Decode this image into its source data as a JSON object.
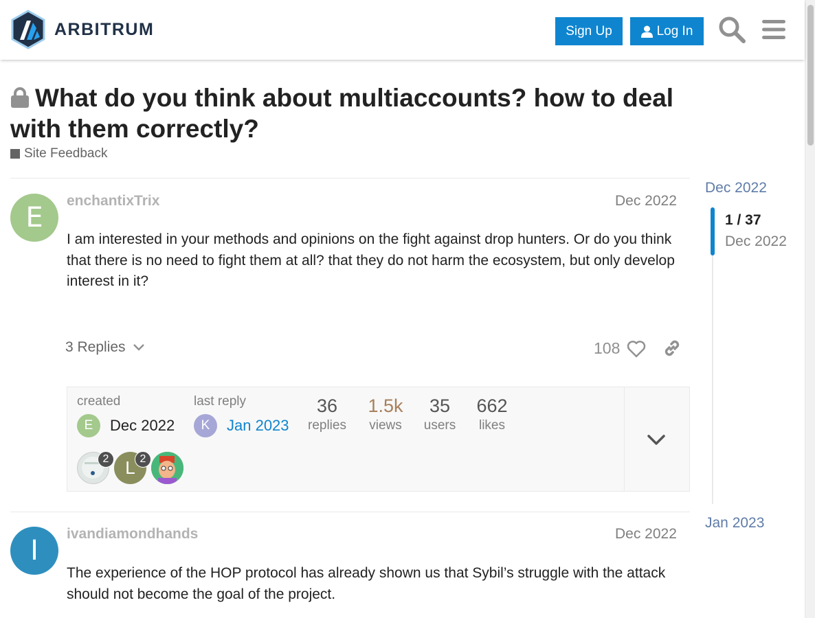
{
  "header": {
    "logo_text": "ARBITRUM",
    "signup_label": "Sign Up",
    "login_label": "Log In",
    "accent_color": "#0f85cf"
  },
  "topic": {
    "title": "What do you think about multiaccounts? how to deal with them correctly?",
    "category": "Site Feedback",
    "category_color": "#646464"
  },
  "posts": [
    {
      "username": "enchantixTrix",
      "avatar_letter": "E",
      "avatar_color": "#a3c98c",
      "date": "Dec 2022",
      "body": "I am interested in your methods and opinions on the fight against drop hunters. Or do you think that there is no need to fight them at all? that they do not harm the ecosystem, but only develop interest in it?",
      "replies_label": "3 Replies",
      "likes": "108"
    },
    {
      "username": "ivandiamondhands",
      "avatar_letter": "I",
      "avatar_color": "#2e8fbf",
      "date": "Dec 2022",
      "body": "The experience of the HOP protocol has already shown us that Sybil’s struggle with the attack should not become the goal of the project."
    }
  ],
  "topic_map": {
    "created_label": "created",
    "created_date": "Dec 2022",
    "created_avatar_letter": "E",
    "created_avatar_color": "#a3c98c",
    "last_reply_label": "last reply",
    "last_reply_date": "Jan 2023",
    "last_reply_avatar_letter": "K",
    "last_reply_avatar_color": "#a6a7d6",
    "stats": [
      {
        "value": "36",
        "label": "replies"
      },
      {
        "value": "1.5k",
        "label": "views"
      },
      {
        "value": "35",
        "label": "users"
      },
      {
        "value": "662",
        "label": "likes"
      }
    ],
    "participants": [
      {
        "badge": "2",
        "color": "#dfe6e3"
      },
      {
        "letter": "L",
        "badge": "2",
        "color": "#8a8e5c"
      },
      {
        "color": "#49b77a"
      }
    ]
  },
  "timeline": {
    "start_date": "Dec 2022",
    "position": "1 / 37",
    "position_date": "Dec 2022",
    "end_date": "Jan 2023"
  }
}
